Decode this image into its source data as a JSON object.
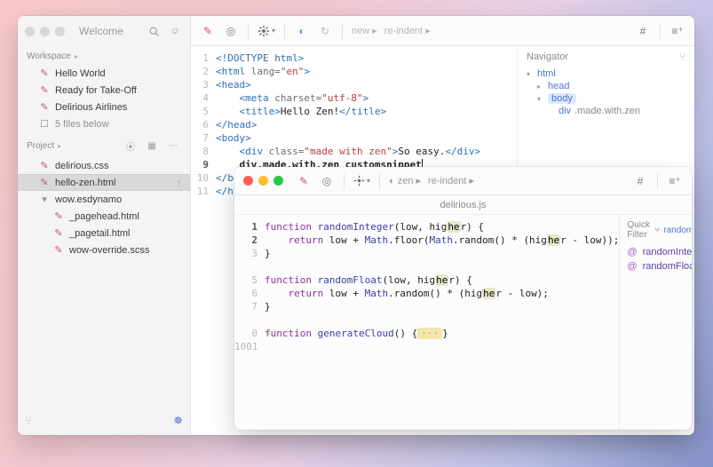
{
  "main": {
    "title": "Welcome",
    "workspace": {
      "header": "Workspace",
      "items": [
        "Hello World",
        "Ready for Take-Off",
        "Delirious Airlines"
      ],
      "below": "5 files below"
    },
    "project": {
      "header": "Project",
      "items": [
        {
          "name": "delirious.css",
          "sel": false,
          "indent": 0,
          "kind": "css"
        },
        {
          "name": "hello-zen.html",
          "sel": true,
          "indent": 0,
          "kind": "html",
          "tail": "↑"
        },
        {
          "name": "wow.esdynamo",
          "sel": false,
          "indent": 0,
          "kind": "folder"
        },
        {
          "name": "_pagehead.html",
          "sel": false,
          "indent": 1,
          "kind": "html"
        },
        {
          "name": "_pagetail.html",
          "sel": false,
          "indent": 1,
          "kind": "html"
        },
        {
          "name": "wow-override.scss",
          "sel": false,
          "indent": 1,
          "kind": "css"
        }
      ]
    },
    "crumbs": [
      "new",
      "re-indent"
    ],
    "code": {
      "lines": [
        "<!DOCTYPE html>",
        "<html lang=\"en\">",
        "<head>",
        "    <meta charset=\"utf-8\">",
        "    <title>Hello Zen!</title>",
        "</head>",
        "<body>",
        "    <div class=\"made with zen\">So easy.</div>",
        "    div.made.with.zen customsnippet",
        "</body>",
        "</html>"
      ],
      "nums": [
        "1",
        "2",
        "3",
        "4",
        "5",
        "6",
        "7",
        "8",
        "9",
        "10",
        "11"
      ]
    },
    "navigator": {
      "title": "Navigator",
      "nodes": [
        {
          "label": "html",
          "level": 1,
          "sel": false
        },
        {
          "label": "head",
          "level": 2,
          "sel": false
        },
        {
          "label": "body",
          "level": 2,
          "sel": true
        },
        {
          "label": "div",
          "cls": ".made.with.zen",
          "level": 3,
          "sel": false
        }
      ]
    }
  },
  "win2": {
    "file": "delirious.js",
    "crumbs": [
      "zen",
      "re-indent"
    ],
    "code": {
      "nums": [
        "1",
        "2",
        "3",
        "",
        "5",
        "6",
        "7",
        "",
        "0",
        "1001"
      ],
      "text": {
        "fn1": "function",
        "name1": "randomInteger",
        "args1": "(low, higher) {",
        "ret1": "return",
        "body1": " low + ",
        "math": "Math",
        "floor": ".floor(",
        "rand": ".random() * (higher - low));",
        "close": "}",
        "name2": "randomFloat",
        "args2": "(low, higher) {",
        "body2": " low + ",
        "rand2": ".random() * (higher - low);",
        "name3": "generateCloud",
        "args3": "() {",
        "fold": "···",
        "end3": "}"
      }
    },
    "quickfilter": {
      "label": "Quick Filter",
      "term": "random",
      "items": [
        "randomInteger",
        "randomFloat"
      ]
    }
  }
}
